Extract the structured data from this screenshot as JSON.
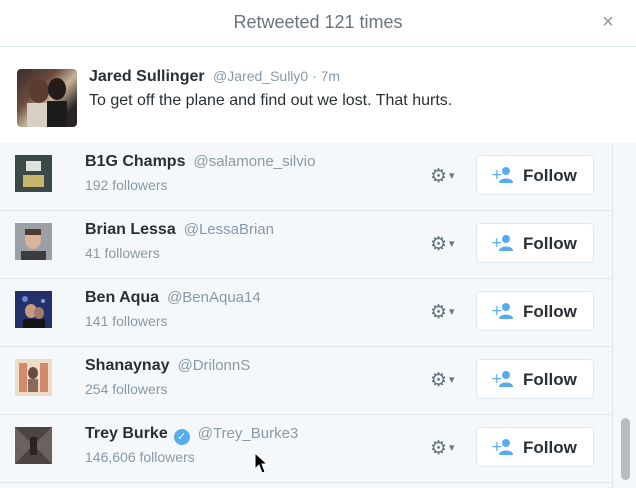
{
  "header": {
    "title": "Retweeted 121 times",
    "close_label": "×"
  },
  "tweet": {
    "name": "Jared Sullinger",
    "handle_time": "@Jared_Sully0 · 7m",
    "text": "To get off the plane and find out we lost. That hurts."
  },
  "users": [
    {
      "name": "B1G Champs",
      "handle": "@salamone_silvio",
      "followers": "192 followers",
      "verified": false
    },
    {
      "name": "Brian Lessa",
      "handle": "@LessaBrian",
      "followers": "41 followers",
      "verified": false
    },
    {
      "name": "Ben Aqua",
      "handle": "@BenAqua14",
      "followers": "141 followers",
      "verified": false
    },
    {
      "name": "Shanaynay",
      "handle": "@DrilonnS",
      "followers": "254 followers",
      "verified": false
    },
    {
      "name": "Trey Burke",
      "handle": "@Trey_Burke3",
      "followers": "146,606 followers",
      "verified": true
    }
  ],
  "follow_label": "Follow",
  "colors": {
    "accent": "#55acee",
    "muted_text": "#8899a6",
    "border": "#e1e8ed"
  }
}
